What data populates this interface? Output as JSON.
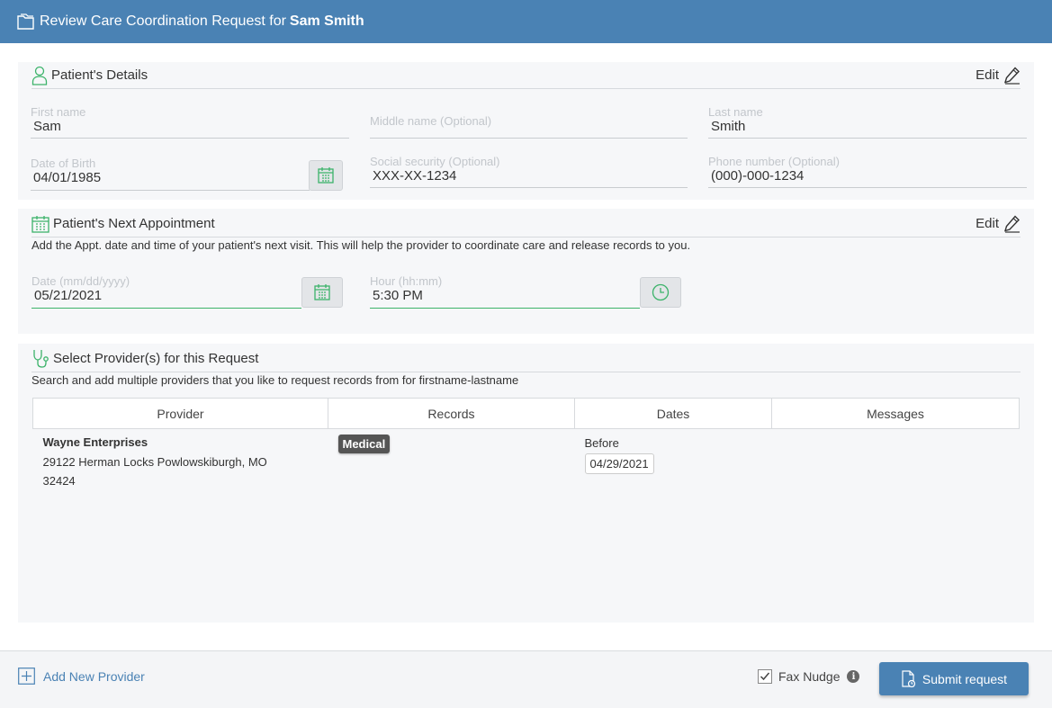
{
  "header": {
    "title_prefix": "Review Care Coordination Request for",
    "patient_name": "Sam Smith"
  },
  "patient_details": {
    "title": "Patient's Details",
    "edit_label": "Edit",
    "first_name": {
      "label": "First name",
      "value": "Sam"
    },
    "middle_name": {
      "placeholder": "Middle name (Optional)",
      "value": ""
    },
    "last_name": {
      "label": "Last name",
      "value": "Smith"
    },
    "dob": {
      "label": "Date of Birth",
      "value": "04/01/1985"
    },
    "ssn": {
      "label": "Social security (Optional)",
      "value": "XXX-XX-1234"
    },
    "phone": {
      "label": "Phone number (Optional)",
      "value": "(000)-000-1234"
    }
  },
  "appointment": {
    "title": "Patient's Next Appointment",
    "edit_label": "Edit",
    "description": "Add the Appt. date and time of your patient's next visit. This will help the provider to coordinate care and release records to you.",
    "date": {
      "label": "Date (mm/dd/yyyy)",
      "value": "05/21/2021"
    },
    "hour": {
      "label": "Hour (hh:mm)",
      "value": "5:30 PM"
    }
  },
  "providers": {
    "title": "Select Provider(s) for this Request",
    "description": "Search and add multiple providers that you like to request records from for firstname-lastname",
    "columns": [
      "Provider",
      "Records",
      "Dates",
      "Messages"
    ],
    "rows": [
      {
        "name": "Wayne Enterprises",
        "address_line1": "29122 Herman Locks Powlowskiburgh, MO",
        "address_line2": "32424",
        "record_type": "Medical",
        "date_qualifier": "Before",
        "date": "04/29/2021",
        "messages": ""
      }
    ]
  },
  "footer": {
    "add_provider_label": "Add New Provider",
    "fax_nudge_label": "Fax Nudge",
    "fax_nudge_checked": true,
    "submit_label": "Submit request"
  },
  "colors": {
    "header_bg": "#4a82b4",
    "accent_green": "#3cb36a",
    "section_bg": "#f6f7f9"
  }
}
